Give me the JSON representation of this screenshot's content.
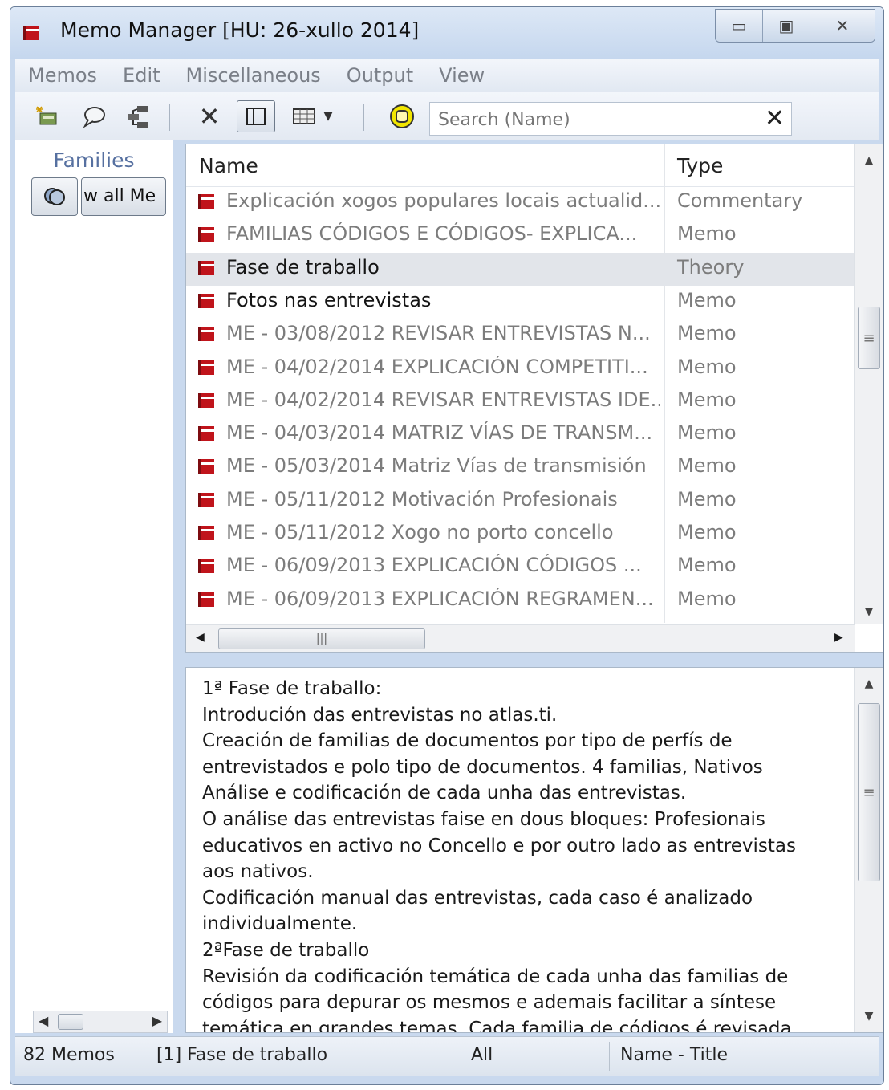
{
  "window": {
    "title": "Memo Manager [HU: 26-xullo 2014]",
    "controls": {
      "minimize": "▭",
      "maximize": "▣",
      "close": "✕"
    }
  },
  "menu": [
    "Memos",
    "Edit",
    "Miscellaneous",
    "Output",
    "View"
  ],
  "toolbar": {
    "search_placeholder": "Search (Name)",
    "search_clear": "✕",
    "delete_symbol": "✕"
  },
  "families": {
    "label": "Families",
    "show_all_button": "w all Me"
  },
  "list": {
    "columns": {
      "name": "Name",
      "type": "Type"
    },
    "rows": [
      {
        "name": "Explicación xogos populares locais actualid...",
        "type": "Commentary",
        "style": "gray"
      },
      {
        "name": "FAMILIAS CÓDIGOS E CÓDIGOS- EXPLICA...",
        "type": "Memo",
        "style": "gray"
      },
      {
        "name": "Fase de traballo",
        "type": "Theory",
        "style": "selected"
      },
      {
        "name": "Fotos nas entrevistas",
        "type": "Memo",
        "style": "dark"
      },
      {
        "name": "ME - 03/08/2012  REVISAR ENTREVISTAS N...",
        "type": "Memo",
        "style": "gray"
      },
      {
        "name": "ME - 04/02/2014 EXPLICACIÓN COMPETITI...",
        "type": "Memo",
        "style": "gray"
      },
      {
        "name": "ME - 04/02/2014 REVISAR ENTREVISTAS IDE...",
        "type": "Memo",
        "style": "gray"
      },
      {
        "name": "ME - 04/03/2014 MATRIZ VÍAS DE TRANSM...",
        "type": "Memo",
        "style": "gray"
      },
      {
        "name": "ME - 05/03/2014 Matriz Vías de transmisión",
        "type": "Memo",
        "style": "gray"
      },
      {
        "name": "ME - 05/11/2012 Motivación Profesionais",
        "type": "Memo",
        "style": "gray"
      },
      {
        "name": "ME - 05/11/2012 Xogo no porto concello",
        "type": "Memo",
        "style": "gray"
      },
      {
        "name": "ME - 06/09/2013 EXPLICACIÓN CÓDIGOS ...",
        "type": "Memo",
        "style": "gray"
      },
      {
        "name": "ME - 06/09/2013 EXPLICACIÓN REGRAMEN...",
        "type": "Memo",
        "style": "gray"
      }
    ]
  },
  "memo_text": [
    "1ª Fase de traballo:",
    "Introdución das entrevistas no atlas.ti.",
    "Creación de familias de documentos por tipo de perfís de",
    "entrevistados e polo tipo de documentos. 4 familias, Nativos",
    "Análise e codificación de cada unha das entrevistas.",
    "O análise das entrevistas faise en dous bloques: Profesionais",
    "educativos en activo no Concello e por outro lado as entrevistas",
    "aos nativos.",
    "Codificación manual das entrevistas, cada caso é analizado",
    "individualmente.",
    "2ªFase de traballo",
    "Revisión da codificación temática de cada unha das familias de",
    "códigos para depurar os mesmos e ademais facilitar a síntese",
    "temática en grandes temas. Cada familia de códigos é revisada"
  ],
  "status": {
    "count": "82 Memos",
    "selected": "[1] Fase de traballo",
    "filter": "All",
    "sort": "Name - Title"
  },
  "colors": {
    "memo_icon": "#c0141b",
    "selection": "#e2e5ea",
    "title_bar": "#c9d9ee"
  }
}
